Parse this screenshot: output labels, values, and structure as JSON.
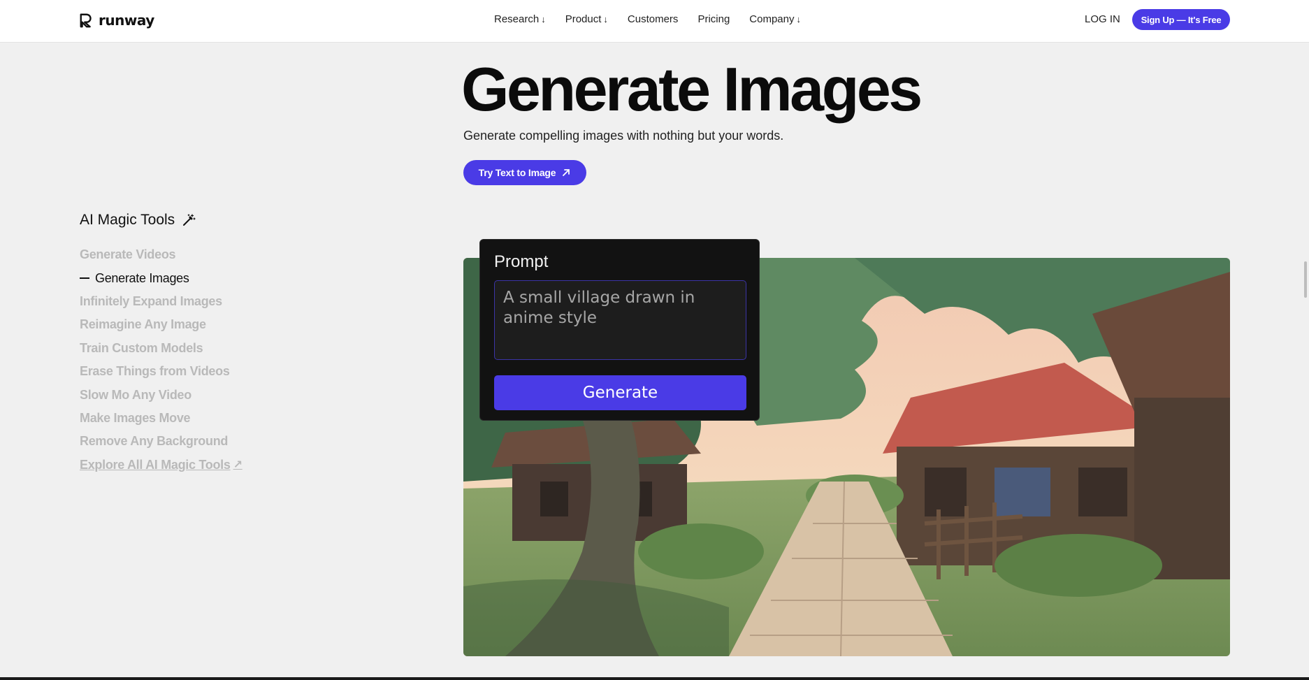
{
  "header": {
    "logo_text": "runway",
    "nav": [
      {
        "label": "Research",
        "has_dropdown": true
      },
      {
        "label": "Product",
        "has_dropdown": true
      },
      {
        "label": "Customers",
        "has_dropdown": false
      },
      {
        "label": "Pricing",
        "has_dropdown": false
      },
      {
        "label": "Company",
        "has_dropdown": true
      }
    ],
    "login": "LOG IN",
    "signup": "Sign Up — It's Free"
  },
  "hero": {
    "title": "Generate Images",
    "subtitle": "Generate compelling images with nothing but your words.",
    "cta": "Try Text to Image"
  },
  "sidebar": {
    "title": "AI Magic Tools",
    "items": [
      {
        "label": "Generate Videos",
        "active": false
      },
      {
        "label": "Generate Images",
        "active": true
      },
      {
        "label": "Infinitely Expand Images",
        "active": false
      },
      {
        "label": "Reimagine Any Image",
        "active": false
      },
      {
        "label": "Train Custom Models",
        "active": false
      },
      {
        "label": "Erase Things from Videos",
        "active": false
      },
      {
        "label": "Slow Mo Any Video",
        "active": false
      },
      {
        "label": "Make Images Move",
        "active": false
      },
      {
        "label": "Remove Any Background",
        "active": false
      }
    ],
    "explore": "Explore All AI Magic Tools"
  },
  "prompt_card": {
    "label": "Prompt",
    "input_value": "A small village drawn in anime style",
    "button": "Generate"
  },
  "colors": {
    "accent": "#4a3be6",
    "page_bg": "#f0f0f0",
    "muted_text": "#b9b9b9"
  }
}
